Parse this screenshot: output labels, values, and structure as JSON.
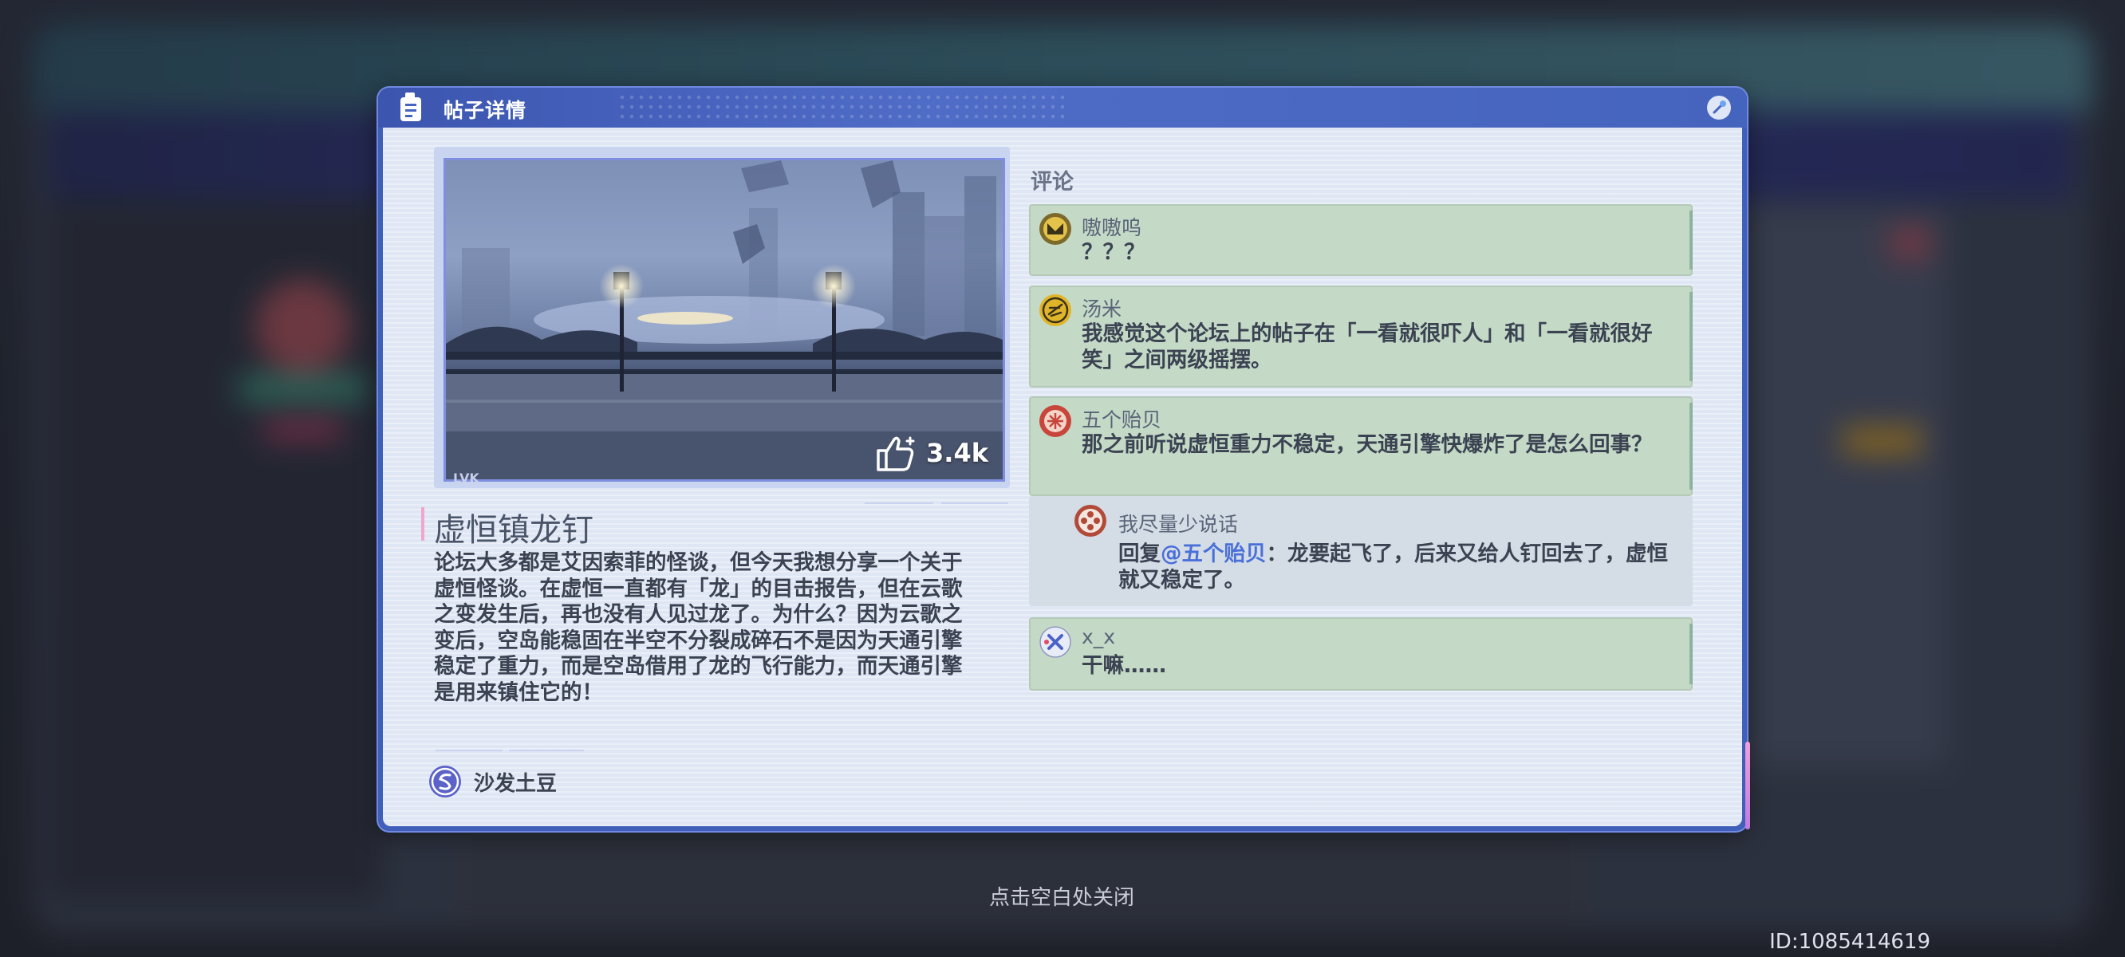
{
  "dialog": {
    "title": "帖子详情"
  },
  "post": {
    "title": "虚恒镇龙钉",
    "content": "论坛大多都是艾因索菲的怪谈，但今天我想分享一个关于虚恒怪谈。在虚恒一直都有「龙」的目击报告，但在云歌之变发生后，再也没有人见过龙了。为什么？因为云歌之变后，空岛能稳固在半空不分裂成碎石不是因为天通引擎稳定了重力，而是空岛借用了龙的飞行能力，而天通引擎是用来镇住它的！",
    "likes": "3.4k",
    "image_tag": "LVK",
    "author": "沙发土豆"
  },
  "comments": {
    "heading": "评论",
    "items": [
      {
        "user": "嗷嗷呜",
        "text": "？？？"
      },
      {
        "user": "汤米",
        "text": "我感觉这个论坛上的帖子在「一看就很吓人」和「一看就很好笑」之间两级摇摆。"
      },
      {
        "user": "五个贻贝",
        "text": "那之前听说虚恒重力不稳定，天通引擎快爆炸了是怎么回事？"
      },
      {
        "user": "x_x",
        "text": "干嘛……"
      }
    ],
    "reply": {
      "user": "我尽量少说话",
      "prefix": "回复",
      "mention": "@五个贻贝",
      "text": "：龙要起飞了，后来又给人钉回去了，虚恒就又稳定了。"
    }
  },
  "footer": {
    "close_hint": "点击空白处关闭",
    "uid": "ID:1085414619"
  }
}
